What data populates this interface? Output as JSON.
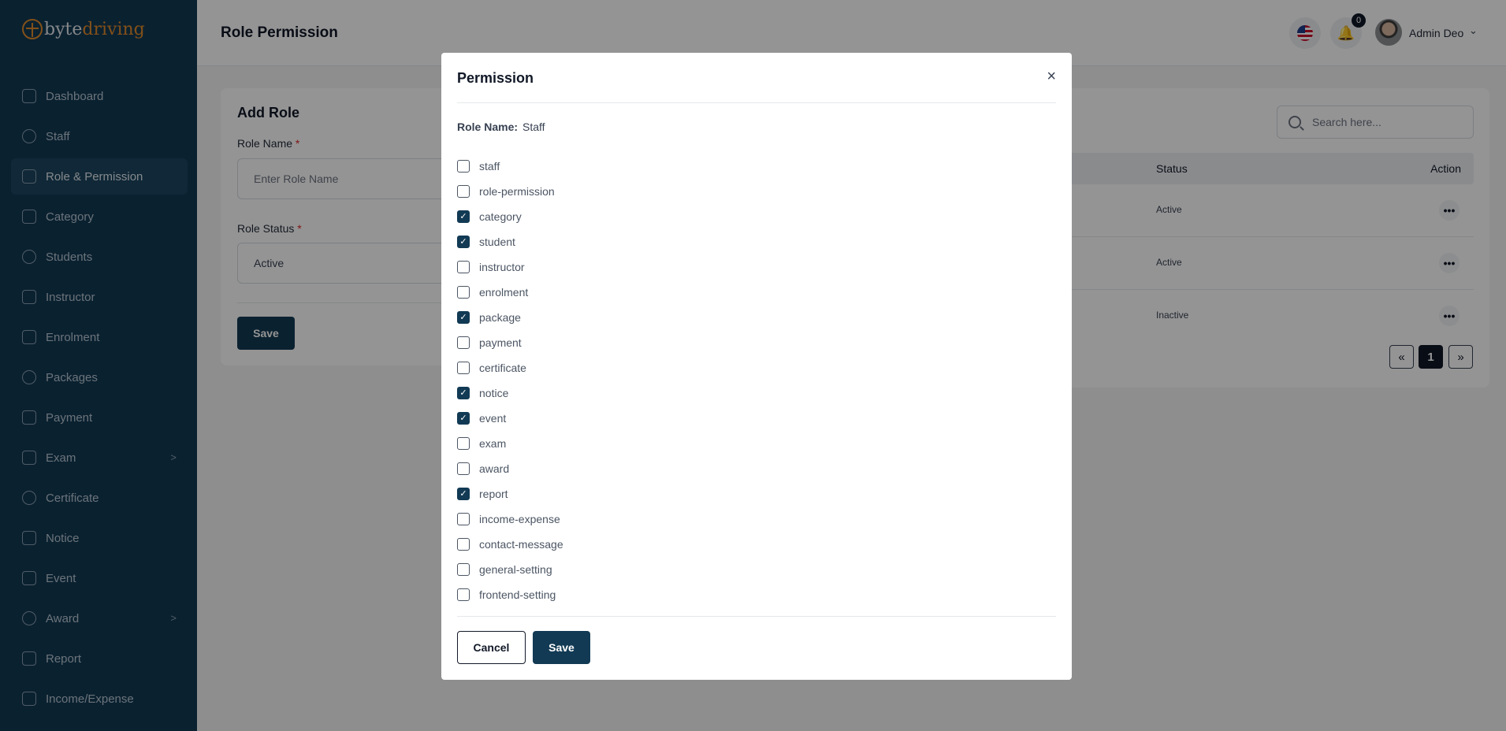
{
  "brand": {
    "part1": "byte",
    "part2": "driving",
    "accent": "#e08a2b"
  },
  "sidebar": {
    "items": [
      {
        "label": "Dashboard",
        "icon": "grid-icon",
        "active": false
      },
      {
        "label": "Staff",
        "icon": "users-icon",
        "active": false
      },
      {
        "label": "Role & Permission",
        "icon": "shield-icon",
        "active": true
      },
      {
        "label": "Category",
        "icon": "tag-icon",
        "active": false
      },
      {
        "label": "Students",
        "icon": "group-icon",
        "active": false
      },
      {
        "label": "Instructor",
        "icon": "user-icon",
        "active": false
      },
      {
        "label": "Enrolment",
        "icon": "enrol-icon",
        "active": false
      },
      {
        "label": "Packages",
        "icon": "layers-icon",
        "active": false
      },
      {
        "label": "Payment",
        "icon": "dollar-icon",
        "active": false
      },
      {
        "label": "Exam",
        "icon": "exam-icon",
        "active": false,
        "chevron": ">"
      },
      {
        "label": "Certificate",
        "icon": "mortarboard-icon",
        "active": false
      },
      {
        "label": "Notice",
        "icon": "notice-icon",
        "active": false
      },
      {
        "label": "Event",
        "icon": "calendar-icon",
        "active": false
      },
      {
        "label": "Award",
        "icon": "award-icon",
        "active": false,
        "chevron": ">"
      },
      {
        "label": "Report",
        "icon": "report-icon",
        "active": false
      },
      {
        "label": "Income/Expense",
        "icon": "wallet-icon",
        "active": false
      }
    ]
  },
  "header": {
    "title": "Role Permission",
    "notification_count": "0",
    "user_name": "Admin Deo",
    "user_chevron": "⌄"
  },
  "add_role": {
    "title": "Add Role",
    "role_name_label": "Role Name",
    "required_mark": "*",
    "role_name_placeholder": "Enter Role Name",
    "role_status_label": "Role Status",
    "role_status_value": "Active",
    "save_label": "Save"
  },
  "roles_table": {
    "search_placeholder": "Search here...",
    "columns": {
      "status": "Status",
      "action": "Action"
    },
    "rows": [
      {
        "status": "Active",
        "action": "•••"
      },
      {
        "status": "Active",
        "action": "•••"
      },
      {
        "status": "Inactive",
        "action": "•••"
      }
    ],
    "pagination": {
      "prev": "«",
      "current": "1",
      "next": "»"
    }
  },
  "modal": {
    "title": "Permission",
    "close": "×",
    "role_name_key": "Role Name:",
    "role_name_value": "Staff",
    "permissions": [
      {
        "label": "staff",
        "checked": false
      },
      {
        "label": "role-permission",
        "checked": false
      },
      {
        "label": "category",
        "checked": true
      },
      {
        "label": "student",
        "checked": true
      },
      {
        "label": "instructor",
        "checked": false
      },
      {
        "label": "enrolment",
        "checked": false
      },
      {
        "label": "package",
        "checked": true
      },
      {
        "label": "payment",
        "checked": false
      },
      {
        "label": "certificate",
        "checked": false
      },
      {
        "label": "notice",
        "checked": true
      },
      {
        "label": "event",
        "checked": true
      },
      {
        "label": "exam",
        "checked": false
      },
      {
        "label": "award",
        "checked": false
      },
      {
        "label": "report",
        "checked": true
      },
      {
        "label": "income-expense",
        "checked": false
      },
      {
        "label": "contact-message",
        "checked": false
      },
      {
        "label": "general-setting",
        "checked": false
      },
      {
        "label": "frontend-setting",
        "checked": false
      }
    ],
    "cancel_label": "Cancel",
    "save_label": "Save"
  },
  "colors": {
    "sidebar_bg": "#123a54",
    "primary": "#123a54",
    "required": "#dc2626"
  }
}
